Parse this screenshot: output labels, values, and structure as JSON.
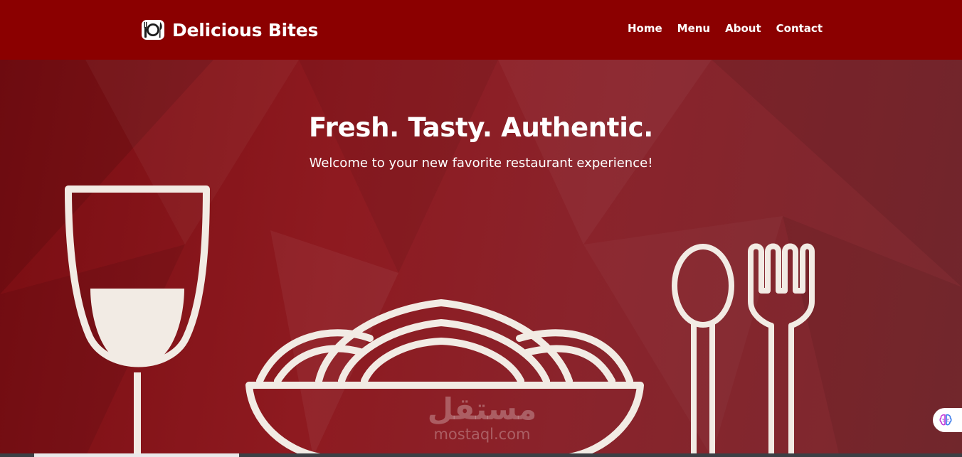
{
  "navbar": {
    "brand_icon": "plate-cutlery-icon",
    "brand_name": "Delicious Bites",
    "links": [
      {
        "label": "Home"
      },
      {
        "label": "Menu"
      },
      {
        "label": "About"
      },
      {
        "label": "Contact"
      }
    ]
  },
  "hero": {
    "title": "Fresh. Tasty. Authentic.",
    "subtitle": "Welcome to your new favorite restaurant experience!",
    "illustration_icons": [
      "wine-glass-icon",
      "noodle-bowl-icon",
      "spoon-icon",
      "fork-icon"
    ]
  },
  "watermark": {
    "arabic": "مستقل",
    "latin": "mostaql.com"
  },
  "floating_button": {
    "icon": "brain-icon"
  },
  "colors": {
    "nav_background": "#8b0000",
    "hero_background": "#8e1a20",
    "line_art": "#f2ebe4",
    "text": "#ffffff"
  }
}
